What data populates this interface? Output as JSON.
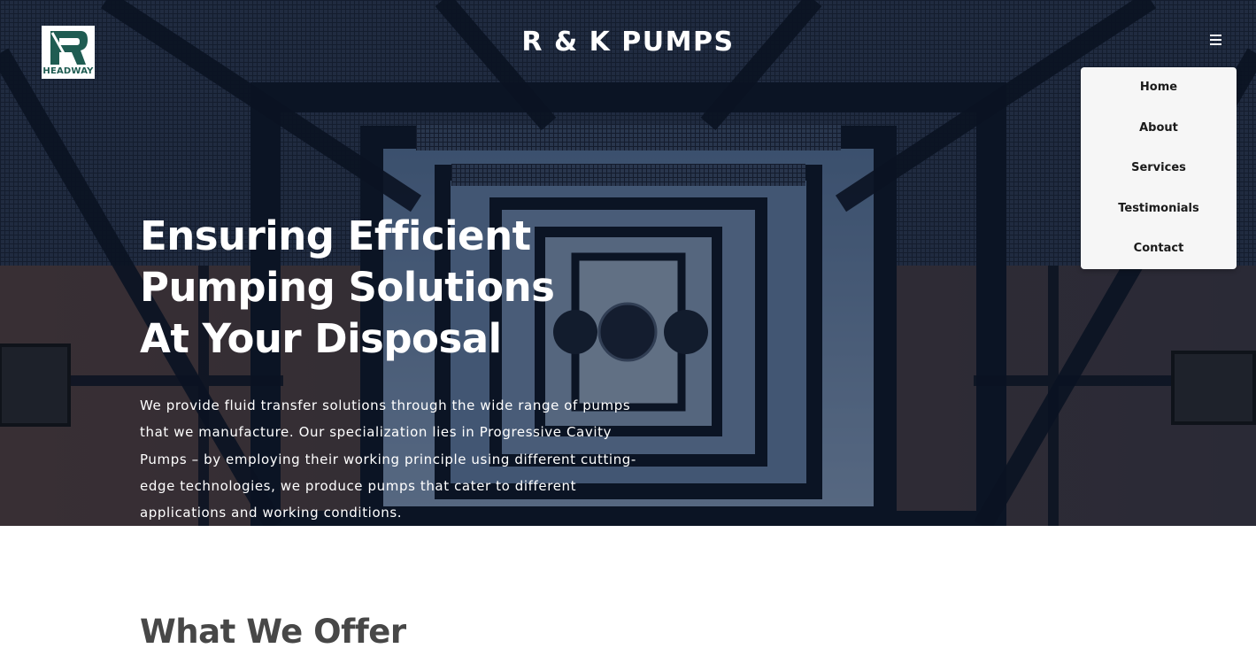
{
  "header": {
    "logo_text": "HEADWAY",
    "brand_title": "R & K PUMPS"
  },
  "nav": {
    "items": [
      {
        "label": "Home"
      },
      {
        "label": "About"
      },
      {
        "label": "Services"
      },
      {
        "label": "Testimonials"
      },
      {
        "label": "Contact"
      }
    ]
  },
  "hero": {
    "headline": "Ensuring Efficient Pumping Solutions At Your Disposal",
    "paragraph": "We provide fluid transfer solutions through the wide range of pumps that we manufacture. Our specialization lies in Progressive Cavity Pumps – by employing their working principle using different cutting-edge technologies, we produce pumps that cater to different applications and working conditions."
  },
  "section": {
    "title": "What We Offer"
  },
  "icons": {
    "menu": "hamburger-menu-icon",
    "logo": "headway-r-logo-icon"
  },
  "colors": {
    "logo_green": "#1f5c52",
    "hero_overlay": "#0b1526",
    "dropdown_bg": "#f6f6f6",
    "heading_dark": "#474747"
  }
}
